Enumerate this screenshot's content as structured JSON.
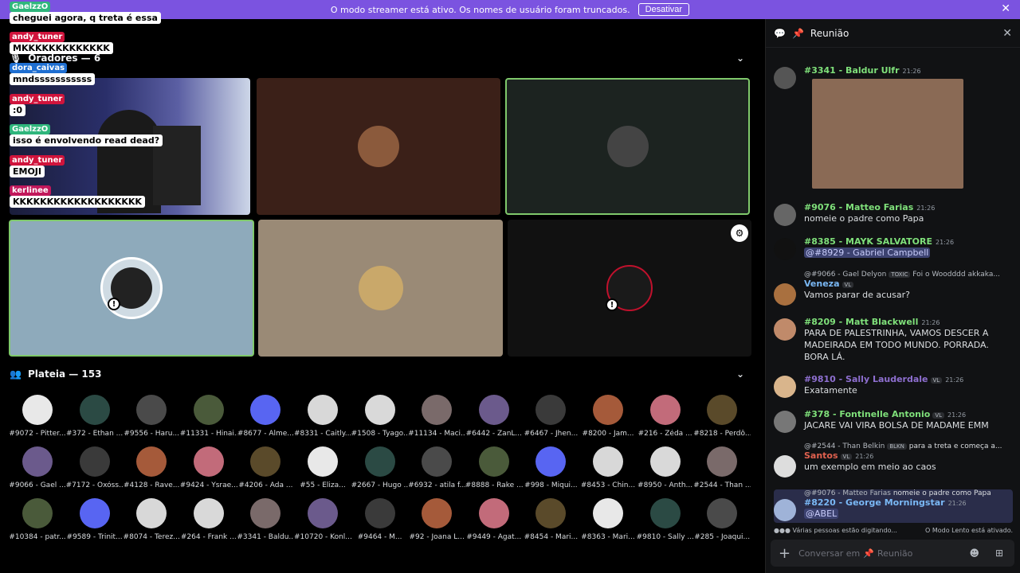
{
  "banner": {
    "text": "O modo streamer está ativo. Os nomes de usuário foram truncados.",
    "button": "Desativar",
    "close": "✕"
  },
  "stage": {
    "speakers_label": "Oradores — 6",
    "audience_label": "Plateia — 153"
  },
  "chat_overlay": [
    {
      "name": "GaelzzO",
      "name_color": "#2fb67c",
      "text": "cheguei agora, q treta é essa"
    },
    {
      "name": "andy_tuner",
      "name_color": "#d0143c",
      "text": "MKKKKKKKKKKKKK"
    },
    {
      "name": "dora_caivas",
      "name_color": "#1f6fd1",
      "text": "mndsssssssssss"
    },
    {
      "name": "andy_tuner",
      "name_color": "#d0143c",
      "text": ":0"
    },
    {
      "name": "GaelzzO",
      "name_color": "#2fb67c",
      "text": "isso é envolvendo read dead?"
    },
    {
      "name": "andy_tuner",
      "name_color": "#d0143c",
      "text": "EMOJI"
    },
    {
      "name": "kerlinee",
      "name_color": "#c2185b",
      "text": "KKKKKKKKKKKKKKKKKKK"
    }
  ],
  "audience": [
    "#9072 - Pitter...",
    "#372 - Ethan ...",
    "#9556 - Haru...",
    "#11331 - Hinai...",
    "#8677 - Alme...",
    "#8331 - Caitly...",
    "#1508 - Tyago...",
    "#11134 - Maci...",
    "#6442 - ZanL...",
    "#6467 - Jhen...",
    "#8200 - Jam...",
    "#216 - Zéda ...",
    "#8218 - Perdô...",
    "#9066 - Gael ...",
    "#7172 - Oxóss...",
    "#4128 - Rave...",
    "#9424 - Ysrae...",
    "#4206 - Ada ...",
    "#55 - Eliza...",
    "#2667 - Hugo ...",
    "#6932 - atila f...",
    "#8888 - Rake ...",
    "#998 - Miqui...",
    "#8453 - Chin...",
    "#8950 - Anth...",
    "#2544 - Than ...",
    "#10384 - patr...",
    "#9589 - Trinit...",
    "#8074 - Terez...",
    "#264 - Frank ...",
    "#3341 - Baldu...",
    "#10720 - Konl...",
    "#9464 - M...",
    "#92 - Joana L...",
    "#9449 - Agat...",
    "#8454 - Mari...",
    "#8363 - Mari...",
    "#9810 - Sally ...",
    "#285 - Joaqui..."
  ],
  "panel": {
    "title": "Reunião",
    "messages": [
      {
        "name": "#3341 - Baldur Ulfr",
        "time": "21:26",
        "text": ""
      },
      {
        "name": "#9076 - Matteo Farias",
        "time": "21:26",
        "text": "nomeie o padre como Papa"
      },
      {
        "name": "#8385 - MAYK SALVATORE",
        "time": "21:26",
        "text": "@#8929 - Gabriel Campbell"
      },
      {
        "reply": "@#9066 - Gael Delyon",
        "reply_badge": "TOXIC",
        "reply_text": "Foi o Woodddd akkaka...",
        "name": "Veneza",
        "badge": "VL",
        "time": "",
        "text": "Vamos parar de acusar?"
      },
      {
        "name": "#8209 - Matt Blackwell",
        "time": "21:26",
        "text": "PARA DE PALESTRINHA, VAMOS DESCER A MADEIRADA EM TODO MUNDO. PORRADA. BORA LÁ."
      },
      {
        "name": "#9810 - Sally Lauderdale",
        "badge": "VL",
        "time": "21:26",
        "text": "Exatamente"
      },
      {
        "name": "#378 - Fontinelle Antonio",
        "badge": "VL",
        "time": "21:26",
        "text": "JACARE VAI VIRA BOLSA DE MADAME EMM"
      },
      {
        "reply": "@#2544 - Than Belkin",
        "reply_badge": "BLKN",
        "reply_text": "para a treta e começa a...",
        "name": "Santos",
        "badge": "VL",
        "time": "21:26",
        "text": "um exemplo em meio ao caos"
      },
      {
        "reply": "@#9076 - Matteo Farias",
        "reply_text": "nomeie o padre como Papa",
        "name": "#8220 - George Morningstar",
        "time": "21:26",
        "text": "@ABEL"
      }
    ],
    "typing": "Várias pessoas estão digitando...",
    "slowmode": "O Modo Lento está ativado.",
    "input_placeholder": "Conversar em",
    "input_channel": "Reunião"
  },
  "colors": {
    "banner": "#7b53e0",
    "accent_green": "#7fe07a",
    "panel_bg": "#111214"
  }
}
